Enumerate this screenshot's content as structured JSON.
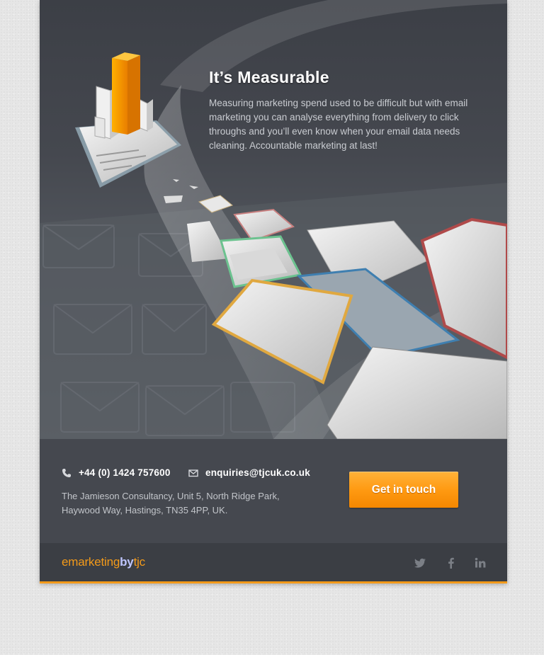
{
  "hero": {
    "title": "It’s Measurable",
    "body": "Measuring marketing spend used to be difficult but with email marketing you can analyse everything from delivery to click throughs and you’ll even know when your email data needs cleaning. Accountable marketing at last!",
    "illustration_icons": [
      "bar-chart-icon",
      "envelope-icon"
    ]
  },
  "contact": {
    "phone": "+44 (0) 1424 757600",
    "email": "enquiries@tjcuk.co.uk",
    "address_line1": "The Jamieson Consultancy, Unit 5, North Ridge Park,",
    "address_line2": "Haywood Way, Hastings, TN35 4PP, UK.",
    "cta_label": "Get in touch",
    "icons": [
      "phone-icon",
      "envelope-icon"
    ]
  },
  "footer": {
    "brand_part1": "emarketing",
    "brand_part2": "by",
    "brand_part3": "tjc",
    "social": [
      {
        "name": "twitter-icon"
      },
      {
        "name": "facebook-icon"
      },
      {
        "name": "linkedin-icon"
      }
    ]
  },
  "colors": {
    "accent_orange": "#f39a1a",
    "hero_bg": "#45484f",
    "footer_bg": "#3b3e44",
    "brand_by": "#bfc6ff"
  }
}
